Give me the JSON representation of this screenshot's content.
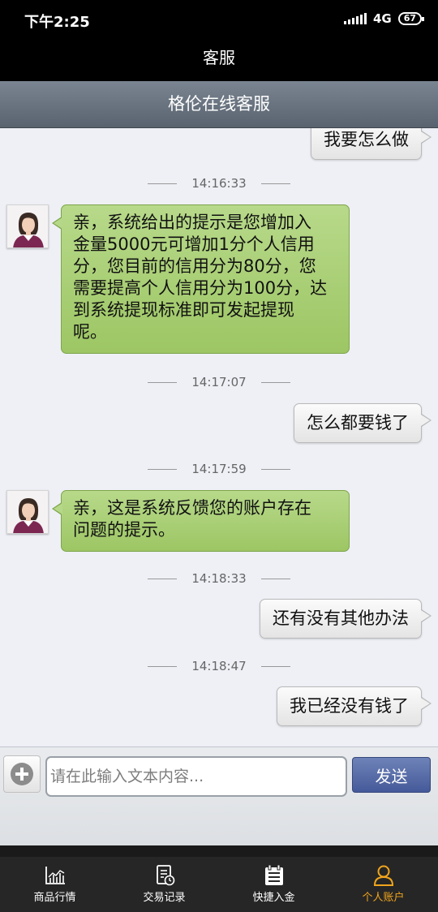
{
  "status": {
    "time": "下午2:25",
    "network": "4G",
    "battery": "67"
  },
  "app_title": "客服",
  "chat_header": "格伦在线客服",
  "messages": [
    {
      "side": "right",
      "text": "我要怎么做"
    },
    {
      "timestamp": "14:16:33"
    },
    {
      "side": "left",
      "lines": [
        "亲，系统给出的提示是您增加入",
        "金量5000元可增加1分个人信用",
        "分，您目前的信用分为80分，您",
        "需要提高个人信用分为100分，达",
        "到系统提现标准即可发起提现",
        "呢。"
      ]
    },
    {
      "timestamp": "14:17:07"
    },
    {
      "side": "right",
      "text": "怎么都要钱了"
    },
    {
      "timestamp": "14:17:59"
    },
    {
      "side": "left",
      "lines": [
        "亲，这是系统反馈您的账户存在",
        "问题的提示。"
      ]
    },
    {
      "timestamp": "14:18:33"
    },
    {
      "side": "right",
      "text": "还有没有其他办法"
    },
    {
      "timestamp": "14:18:47"
    },
    {
      "side": "right",
      "text": "我已经没有钱了"
    }
  ],
  "input": {
    "placeholder": "请在此输入文本内容...",
    "value": "",
    "send_label": "发送"
  },
  "tabs": [
    {
      "label": "商品行情",
      "icon": "chart-icon",
      "active": false
    },
    {
      "label": "交易记录",
      "icon": "record-icon",
      "active": false
    },
    {
      "label": "快捷入金",
      "icon": "calendar-icon",
      "active": false
    },
    {
      "label": "个人账户",
      "icon": "user-icon",
      "active": true
    }
  ],
  "colors": {
    "active_tab": "#f0a51c",
    "agent_bubble": "#a9cf77",
    "send_button": "#4f64a4"
  }
}
